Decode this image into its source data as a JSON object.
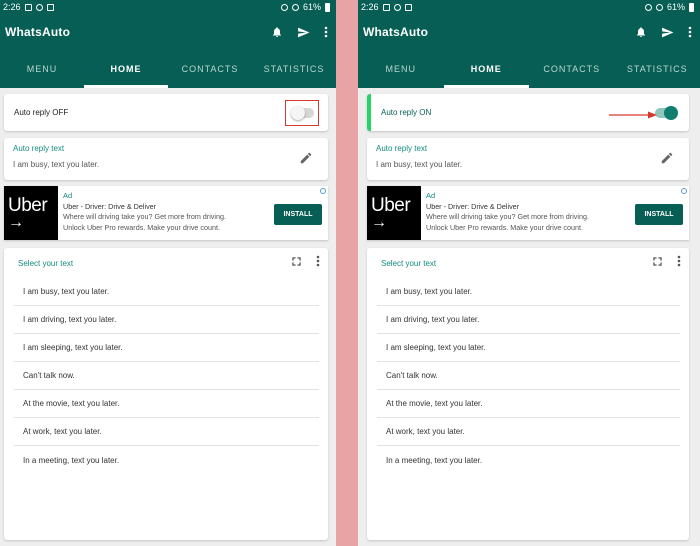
{
  "status": {
    "time": "2:26",
    "battery": "61%"
  },
  "app": {
    "title": "WhatsAuto"
  },
  "tabs": [
    "MENU",
    "HOME",
    "CONTACTS",
    "STATISTICS"
  ],
  "auto_reply": {
    "off_label": "Auto reply OFF",
    "on_label": "Auto reply ON"
  },
  "reply_text": {
    "label": "Auto reply text",
    "value": "I am busy, text you later."
  },
  "ad": {
    "logo_text": "Uber",
    "logo_arrow": "→",
    "tag": "Ad",
    "title": "Uber - Driver: Drive & Deliver",
    "line1": "Where will driving take you? Get more from driving.",
    "line2": "Unlock Uber Pro rewards. Make your drive count.",
    "button": "INSTALL"
  },
  "select_text": {
    "label": "Select your text",
    "items": [
      "I am busy, text you later.",
      "I am driving, text you later.",
      "I am sleeping, text you later.",
      "Can't talk now.",
      "At the movie, text you later.",
      "At work, text you later.",
      "In a meeting, text you later."
    ]
  },
  "colors": {
    "primary": "#075e54",
    "accent": "#25d366",
    "annotation": "#d63a2f"
  },
  "icons": [
    "bell-icon",
    "send-icon",
    "more-vert-icon",
    "pencil-icon",
    "fullscreen-icon",
    "adchoices-icon"
  ]
}
